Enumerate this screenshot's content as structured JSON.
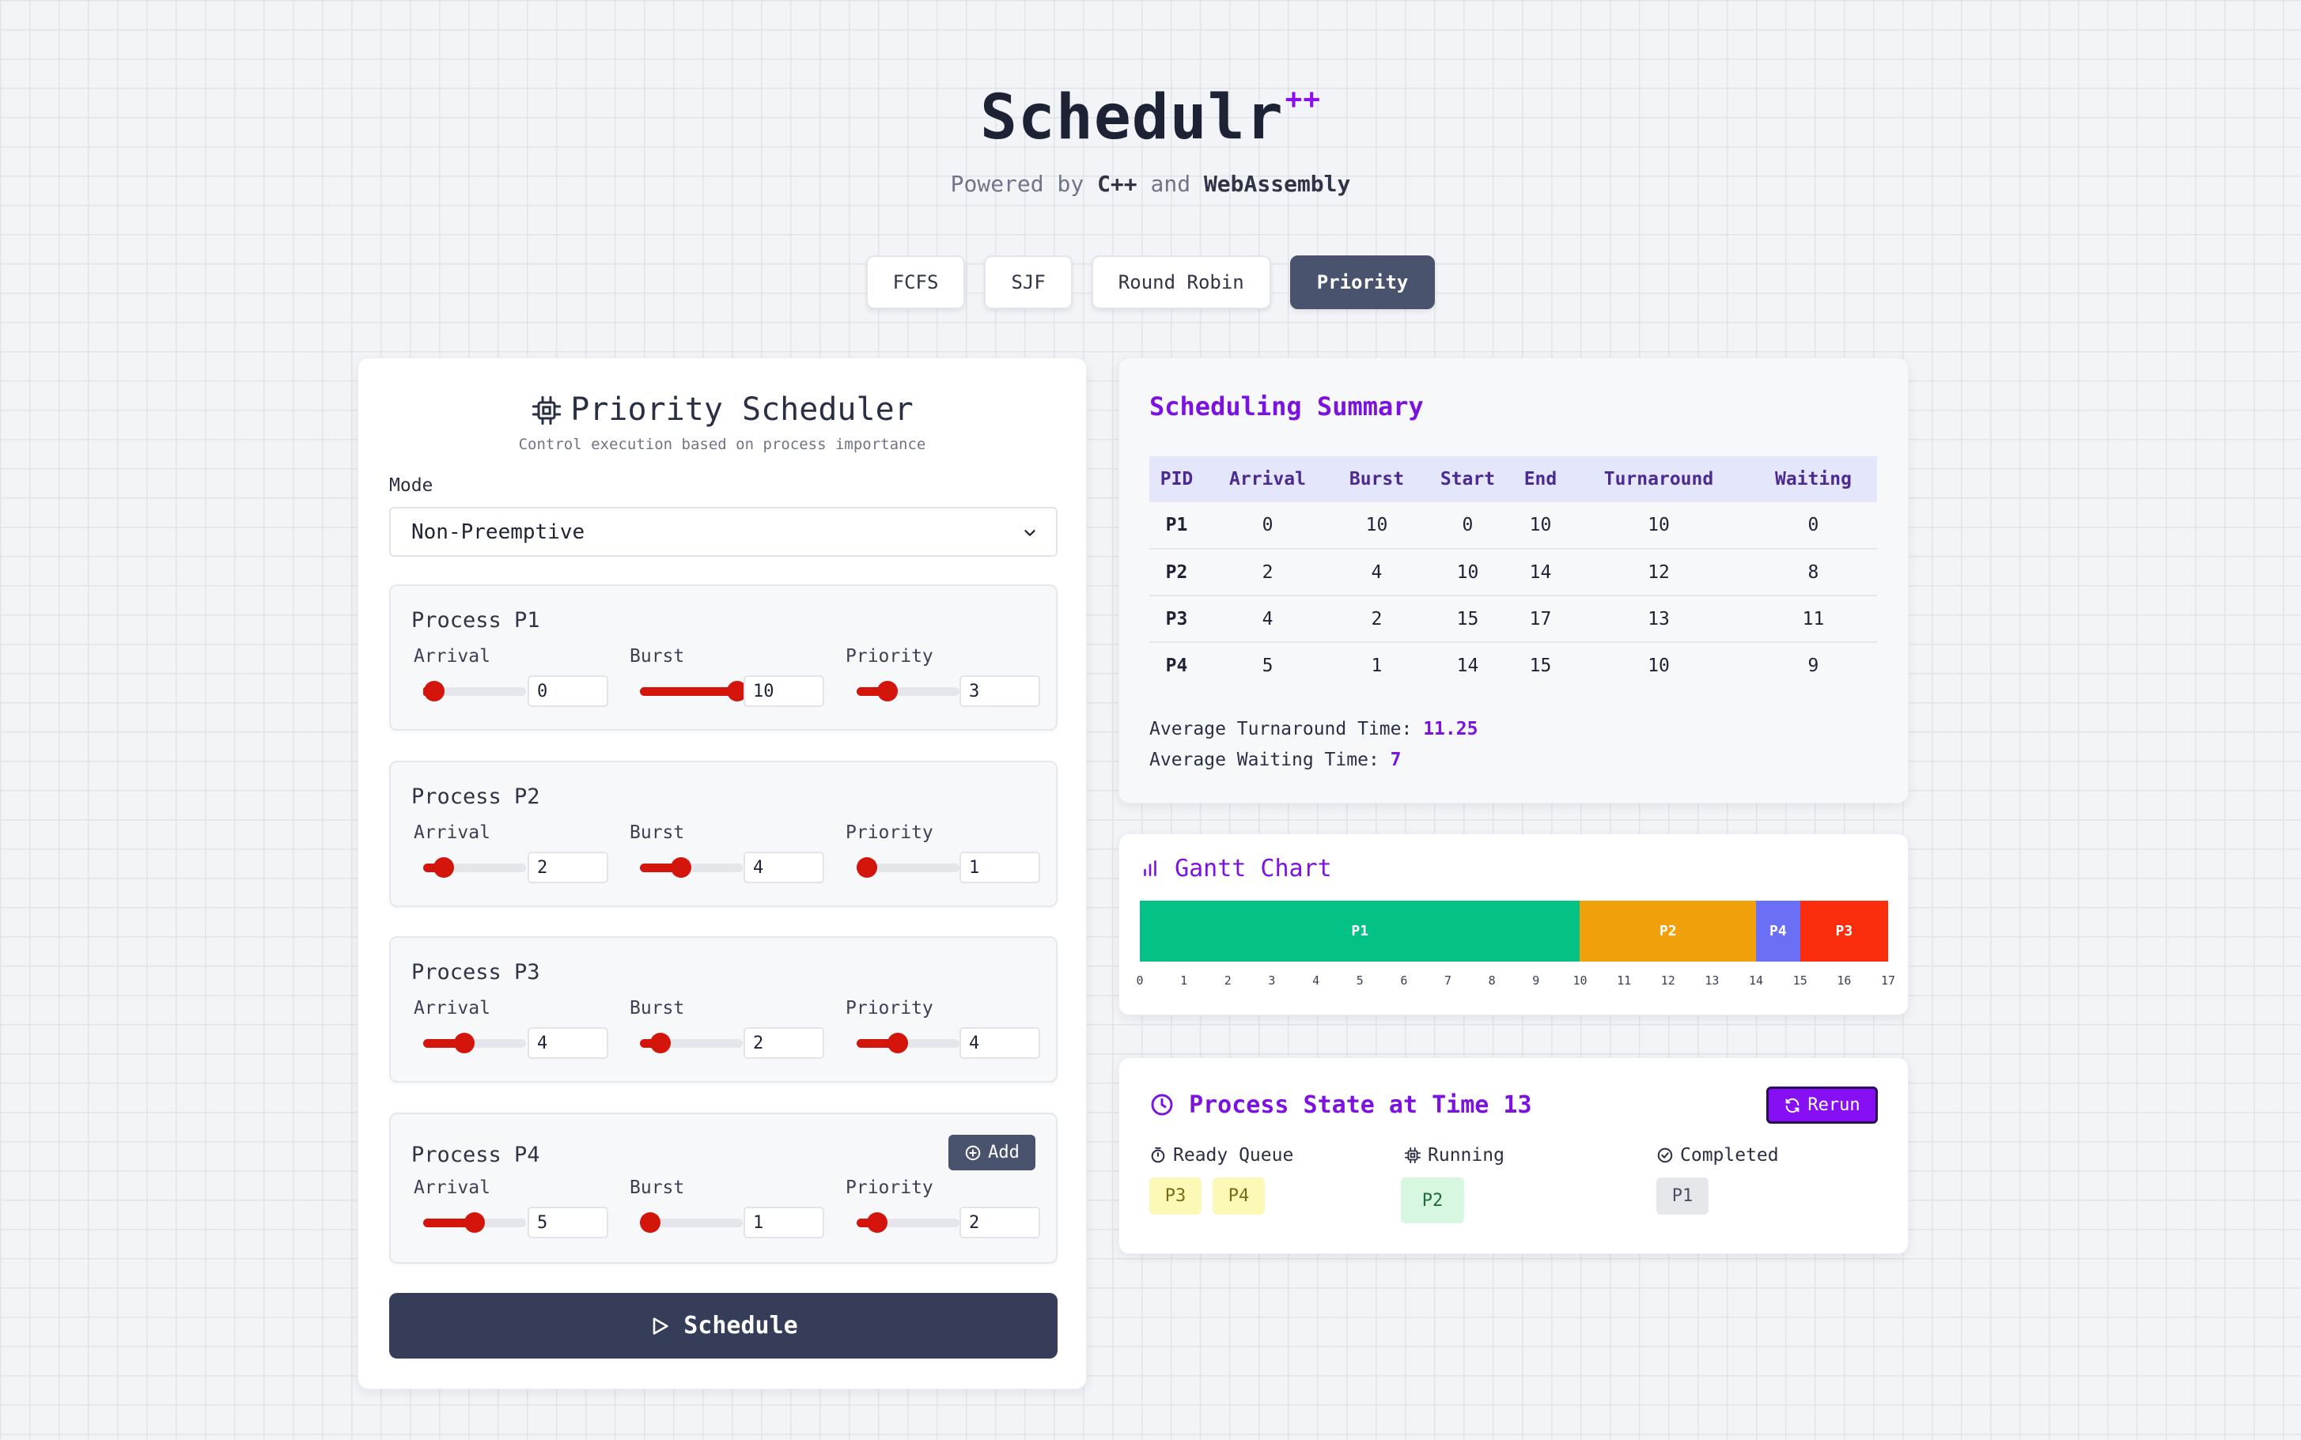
{
  "app": {
    "name": "Schedulr",
    "name_suffix": "++",
    "subtitle_prefix": "Powered by",
    "subtitle_tech1": "C++",
    "subtitle_and": "and",
    "subtitle_tech2": "WebAssembly"
  },
  "tabs": [
    {
      "label": "FCFS",
      "active": false
    },
    {
      "label": "SJF",
      "active": false
    },
    {
      "label": "Round Robin",
      "active": false
    },
    {
      "label": "Priority",
      "active": true
    }
  ],
  "scheduler": {
    "title": "Priority Scheduler",
    "subtitle": "Control execution based on process importance",
    "icon": "cpu-icon",
    "mode_label": "Mode",
    "mode_value": "Non-Preemptive",
    "field_labels": {
      "arrival": "Arrival",
      "burst": "Burst",
      "priority": "Priority"
    },
    "add_label": "Add",
    "schedule_label": "Schedule",
    "accent_color": "#d3150b",
    "processes": [
      {
        "title": "Process P1",
        "arrival": "0",
        "burst": "10",
        "priority": "3"
      },
      {
        "title": "Process P2",
        "arrival": "2",
        "burst": "4",
        "priority": "1"
      },
      {
        "title": "Process P3",
        "arrival": "4",
        "burst": "2",
        "priority": "4"
      },
      {
        "title": "Process P4",
        "arrival": "5",
        "burst": "1",
        "priority": "2"
      }
    ]
  },
  "summary": {
    "title": "Scheduling Summary",
    "columns": [
      "PID",
      "Arrival",
      "Burst",
      "Start",
      "End",
      "Turnaround",
      "Waiting"
    ],
    "rows": [
      [
        "P1",
        "0",
        "10",
        "0",
        "10",
        "10",
        "0"
      ],
      [
        "P2",
        "2",
        "4",
        "10",
        "14",
        "12",
        "8"
      ],
      [
        "P3",
        "4",
        "2",
        "15",
        "17",
        "13",
        "11"
      ],
      [
        "P4",
        "5",
        "1",
        "14",
        "15",
        "10",
        "9"
      ]
    ],
    "avg_turnaround_label": "Average Turnaround Time:",
    "avg_turnaround_value": "11.25",
    "avg_waiting_label": "Average Waiting Time:",
    "avg_waiting_value": "7"
  },
  "gantt": {
    "title": "Gantt Chart",
    "icon": "bar-chart-icon",
    "total": 17,
    "segments": [
      {
        "label": "P1",
        "start": 0,
        "end": 10,
        "color": "#04c285"
      },
      {
        "label": "P2",
        "start": 10,
        "end": 14,
        "color": "#f0a00a"
      },
      {
        "label": "P4",
        "start": 14,
        "end": 15,
        "color": "#6b6ff5"
      },
      {
        "label": "P3",
        "start": 15,
        "end": 17,
        "color": "#fa2e0d"
      }
    ],
    "ticks": [
      "0",
      "1",
      "2",
      "3",
      "4",
      "5",
      "6",
      "7",
      "8",
      "9",
      "10",
      "11",
      "12",
      "13",
      "14",
      "15",
      "16",
      "17"
    ]
  },
  "state": {
    "title": "Process State at Time 13",
    "rerun_label": "Rerun",
    "ready_label": "Ready Queue",
    "running_label": "Running",
    "completed_label": "Completed",
    "ready": [
      "P3",
      "P4"
    ],
    "running": [
      "P2"
    ],
    "completed": [
      "P1"
    ]
  }
}
